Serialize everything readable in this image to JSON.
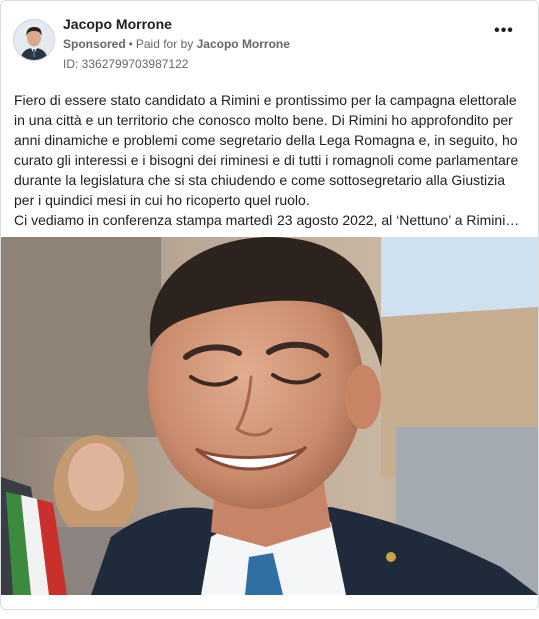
{
  "post": {
    "author": "Jacopo Morrone",
    "sponsored_label": "Sponsored",
    "paid_for_label": "Paid for by",
    "payer": "Jacopo Morrone",
    "ad_id": "ID: 3362799703987122",
    "more_icon": "ellipsis-icon",
    "text_paragraph_1": "Fiero di essere stato candidato a Rimini e prontissimo per la campagna elettorale in una città e un territorio che conosco molto bene. Di Rimini ho approfondito per anni dinamiche e problemi come segretario della Lega Romagna e, in seguito, ho curato gli interessi e i bisogni dei riminesi e di tutti i romagnoli come parlamentare durante la legislatura che si sta chiudendo e come sottosegretario alla Giustizia per i quindici mesi in cui ho ricoperto quel ruolo.",
    "text_paragraph_2": "Ci vediamo in conferenza stampa martedì 23 agosto 2022, al ‘Nettuno’ a Rimini…"
  }
}
